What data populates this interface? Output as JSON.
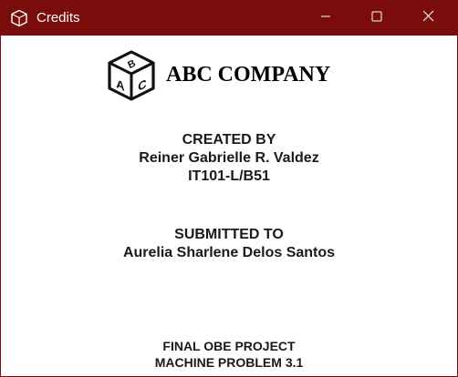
{
  "window": {
    "title": "Credits",
    "titlebar_color": "#7a0c0c",
    "icons": {
      "app": "abc-blocks-icon",
      "minimize": "minimize-icon",
      "maximize": "maximize-icon",
      "close": "close-icon"
    }
  },
  "header": {
    "logo_icon": "abc-cube-logo-icon",
    "logo_letters": [
      "A",
      "B",
      "C"
    ],
    "company_name": "ABC COMPANY"
  },
  "created": {
    "heading": "CREATED BY",
    "name": "Reiner Gabrielle R. Valdez",
    "section": "IT101-L/B51"
  },
  "submitted": {
    "heading": "SUBMITTED TO",
    "name": "Aurelia Sharlene Delos Santos"
  },
  "project": {
    "line1": "FINAL OBE PROJECT",
    "line2": "MACHINE PROBLEM 3.1"
  }
}
